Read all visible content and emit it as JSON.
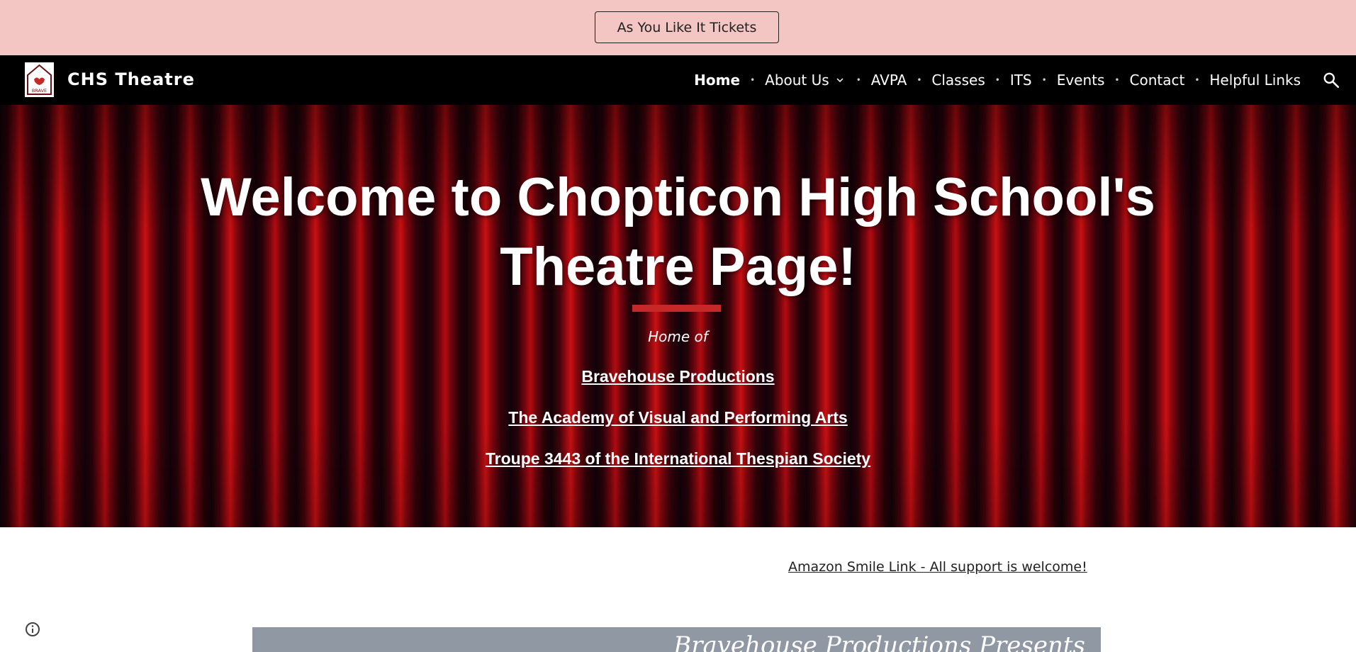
{
  "announcement": {
    "button_label": "As You Like It Tickets"
  },
  "header": {
    "site_title": "CHS Theatre",
    "logo_text": "BRAVE",
    "nav": [
      {
        "label": "Home",
        "active": true
      },
      {
        "label": "About Us",
        "has_dropdown": true
      },
      {
        "label": "AVPA"
      },
      {
        "label": "Classes"
      },
      {
        "label": "ITS"
      },
      {
        "label": "Events"
      },
      {
        "label": "Contact"
      },
      {
        "label": "Helpful Links"
      }
    ],
    "search_icon": "search-icon"
  },
  "hero": {
    "title_line1": "Welcome to Chopticon High School's",
    "title_line2": "Theatre Page!",
    "subtitle": "Home of",
    "links": [
      "Bravehouse Productions",
      "The Academy of Visual and Performing Arts",
      "Troupe 3443 of the International Thespian Society"
    ],
    "accent_color": "#c62828"
  },
  "content": {
    "amazon_link": "Amazon Smile Link - All support is welcome!",
    "banner_text": "Bravehouse Productions Presents"
  },
  "colors": {
    "announcement_bg": "#f4c6c3",
    "nav_bg": "#000000",
    "banner_bg": "#8f98a3"
  }
}
